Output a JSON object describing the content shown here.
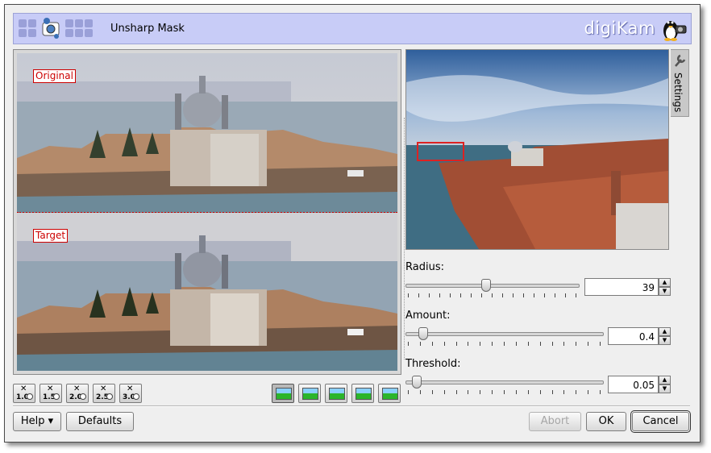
{
  "header": {
    "title": "Unsharp Mask",
    "brand": "digiKam"
  },
  "preview": {
    "original_label": "Original",
    "target_label": "Target"
  },
  "zoom_buttons": [
    "1.0",
    "1.5",
    "2.0",
    "2.5",
    "3.0"
  ],
  "settings_tab": {
    "label": "Settings"
  },
  "controls": {
    "radius": {
      "label": "Radius:",
      "value": "39",
      "level": 0.46
    },
    "amount": {
      "label": "Amount:",
      "value": "0.4",
      "level": 0.08
    },
    "threshold": {
      "label": "Threshold:",
      "value": "0.05",
      "level": 0.05
    }
  },
  "buttons": {
    "help": "Help",
    "defaults": "Defaults",
    "abort": "Abort",
    "ok": "OK",
    "cancel": "Cancel"
  },
  "colors": {
    "banner": "#c8ccf7",
    "accent_red": "#cc0000"
  }
}
